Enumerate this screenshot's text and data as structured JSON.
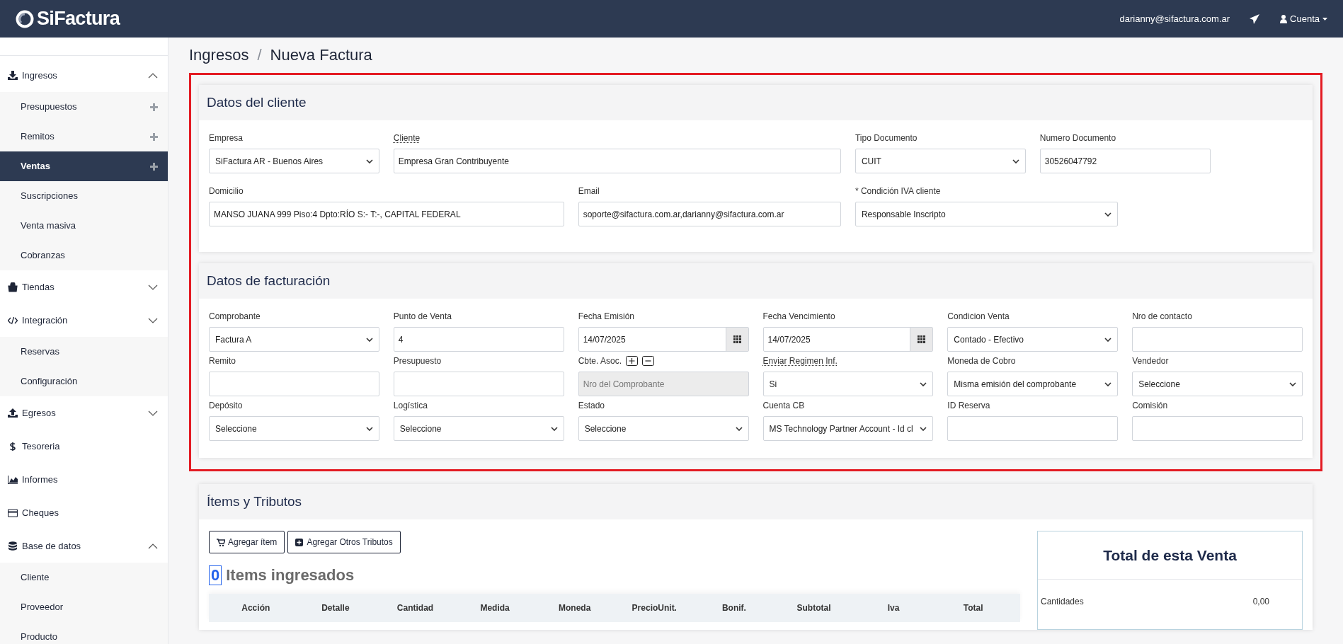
{
  "app": {
    "logo": "SiFactura",
    "user_email": "darianny@sifactura.com.ar",
    "account_menu": "Cuenta"
  },
  "sidebar": {
    "items": [
      {
        "label": "Ingresos",
        "expanded": true,
        "children": [
          {
            "label": "Presupuestos",
            "selected": false,
            "add": true
          },
          {
            "label": "Remitos",
            "selected": false,
            "add": true
          },
          {
            "label": "Ventas",
            "selected": true,
            "add": true
          },
          {
            "label": "Suscripciones",
            "selected": false,
            "add": false
          },
          {
            "label": "Venta masiva",
            "selected": false,
            "add": false
          },
          {
            "label": "Cobranzas",
            "selected": false,
            "add": false
          }
        ]
      },
      {
        "label": "Tiendas",
        "expanded": false
      },
      {
        "label": "Integración",
        "expanded": false,
        "children": [
          {
            "label": "Reservas",
            "selected": false,
            "add": false
          },
          {
            "label": "Configuración",
            "selected": false,
            "add": false
          }
        ]
      },
      {
        "label": "Egresos",
        "expanded": false
      },
      {
        "label": "Tesoreria"
      },
      {
        "label": "Informes"
      },
      {
        "label": "Cheques"
      },
      {
        "label": "Base de datos",
        "expanded": true,
        "children": [
          {
            "label": "Cliente",
            "selected": false,
            "add": false
          },
          {
            "label": "Proveedor",
            "selected": false,
            "add": false
          },
          {
            "label": "Producto",
            "selected": false,
            "add": false
          }
        ]
      }
    ]
  },
  "breadcrumb": [
    "Ingresos",
    "/",
    "Nueva Factura"
  ],
  "sections": [
    {
      "title": "Datos del cliente",
      "rows": [
        [
          {
            "label": "Empresa",
            "kind": "select",
            "value": "SiFactura AR - Buenos Aires"
          },
          {
            "label": "Cliente",
            "kind": "input",
            "value": "Empresa Gran Contribuyente",
            "dotted_underline": true
          },
          {
            "label": "Tipo Documento",
            "kind": "select",
            "value": "CUIT"
          },
          {
            "label": "Numero Documento",
            "kind": "input",
            "value": "30526047792"
          }
        ],
        [
          {
            "label": "Domicilio",
            "kind": "input",
            "value": "MANSO JUANA 999 Piso:4 Dpto:RÍO S:- T:-, CAPITAL FEDERAL"
          },
          {
            "label": "Email",
            "kind": "input",
            "value": "soporte@sifactura.com.ar,darianny@sifactura.com.ar"
          },
          {
            "label": "* Condición IVA cliente",
            "kind": "select",
            "value": "Responsable Inscripto"
          }
        ]
      ]
    },
    {
      "title": "Datos de facturación",
      "rows": [
        [
          {
            "label": "Comprobante",
            "kind": "select",
            "value": "Factura A"
          },
          {
            "label": "Punto de Venta",
            "kind": "input",
            "value": "4"
          },
          {
            "label": "Fecha Emisión",
            "kind": "date",
            "value": "14/07/2025"
          },
          {
            "label": "Fecha Vencimiento",
            "kind": "date",
            "value": "14/07/2025"
          },
          {
            "label": "Condicion Venta",
            "kind": "select",
            "value": "Contado - Efectivo"
          },
          {
            "label": "Nro de contacto",
            "kind": "input"
          }
        ],
        [
          {
            "label": "Remito",
            "kind": "input"
          },
          {
            "label": "Presupuesto",
            "kind": "input"
          },
          {
            "label": "Cbte. Asoc.",
            "kind": "input",
            "disabled": true,
            "add_remove": true,
            "placeholder": "Nro del Comprobante"
          },
          {
            "label": "Enviar Regimen Inf.",
            "kind": "select",
            "value": "Si",
            "dotted_underline": true
          },
          {
            "label": "Moneda de Cobro",
            "kind": "select",
            "value": "Misma emisión del comprobante"
          },
          {
            "label": "Vendedor",
            "kind": "select",
            "value": "Seleccione"
          }
        ],
        [
          {
            "label": "Depósito",
            "kind": "select",
            "value": "Seleccione"
          },
          {
            "label": "Logística",
            "kind": "select",
            "value": "Seleccione"
          },
          {
            "label": "Estado",
            "kind": "select",
            "value": "Seleccione"
          },
          {
            "label": "Cuenta CB",
            "kind": "select",
            "value": "MS Technology Partner Account - Id cl"
          },
          {
            "label": "ID Reserva",
            "kind": "input"
          },
          {
            "label": "Comisión",
            "kind": "input"
          }
        ]
      ]
    }
  ],
  "items": {
    "title": "Ítems y Tributos",
    "buttons": [
      {
        "label": "Agregar ítem"
      },
      {
        "label": "Agregar Otros Tributos"
      }
    ],
    "count": "0",
    "count_label": "Items ingresados",
    "columns": [
      "Acción",
      "Detalle",
      "Cantidad",
      "Medida",
      "Moneda",
      "PrecioUnit.",
      "Bonif.",
      "Subtotal",
      "Iva",
      "Total"
    ],
    "total": {
      "title": "Total de esta Venta",
      "rows": [
        {
          "label": "Cantidades",
          "value": "0,00"
        }
      ]
    }
  }
}
